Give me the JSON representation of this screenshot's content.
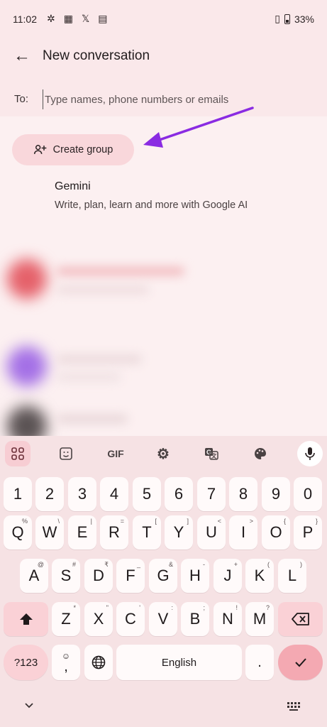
{
  "status_bar": {
    "time": "11:02",
    "battery": "33%"
  },
  "header": {
    "title": "New conversation"
  },
  "recipient": {
    "label": "To:",
    "placeholder": "Type names, phone numbers or emails"
  },
  "actions": {
    "create_group_label": "Create group"
  },
  "suggestion": {
    "name": "Gemini",
    "description": "Write, plan, learn and more with Google AI"
  },
  "keyboard": {
    "toolbar": {
      "gif_label": "GIF"
    },
    "row_numbers": [
      "1",
      "2",
      "3",
      "4",
      "5",
      "6",
      "7",
      "8",
      "9",
      "0"
    ],
    "row_top": [
      {
        "key": "Q",
        "sub": "%"
      },
      {
        "key": "W",
        "sub": "\\"
      },
      {
        "key": "E",
        "sub": "|"
      },
      {
        "key": "R",
        "sub": "="
      },
      {
        "key": "T",
        "sub": "["
      },
      {
        "key": "Y",
        "sub": "]"
      },
      {
        "key": "U",
        "sub": "<"
      },
      {
        "key": "I",
        "sub": ">"
      },
      {
        "key": "O",
        "sub": "{"
      },
      {
        "key": "P",
        "sub": "}"
      }
    ],
    "row_mid": [
      {
        "key": "A",
        "sub": "@"
      },
      {
        "key": "S",
        "sub": "#"
      },
      {
        "key": "D",
        "sub": "₹"
      },
      {
        "key": "F",
        "sub": "_"
      },
      {
        "key": "G",
        "sub": "&"
      },
      {
        "key": "H",
        "sub": "-"
      },
      {
        "key": "J",
        "sub": "+"
      },
      {
        "key": "K",
        "sub": "("
      },
      {
        "key": "L",
        "sub": ")"
      }
    ],
    "row_bottom": [
      {
        "key": "Z",
        "sub": "*"
      },
      {
        "key": "X",
        "sub": "\""
      },
      {
        "key": "C",
        "sub": "'"
      },
      {
        "key": "V",
        "sub": ":"
      },
      {
        "key": "B",
        "sub": ";"
      },
      {
        "key": "N",
        "sub": "!"
      },
      {
        "key": "M",
        "sub": "?"
      }
    ],
    "symbols_label": "?123",
    "comma_label": ",",
    "space_label": "English",
    "period_label": "."
  }
}
